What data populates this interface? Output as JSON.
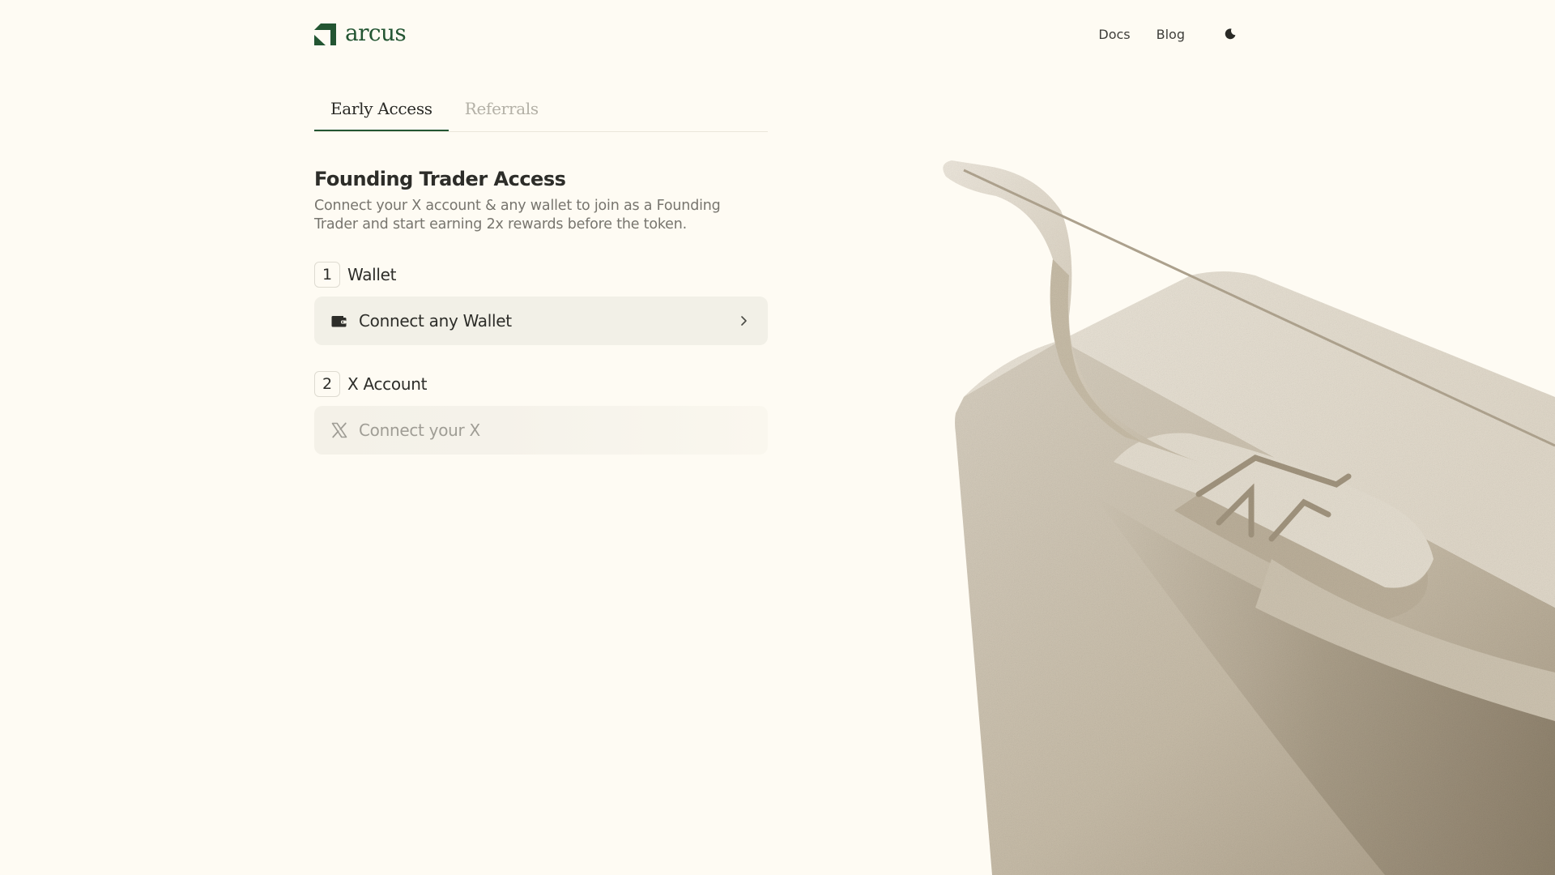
{
  "header": {
    "brand_name": "arcus",
    "nav": {
      "docs": "Docs",
      "blog": "Blog"
    }
  },
  "tabs": [
    {
      "label": "Early Access",
      "active": true
    },
    {
      "label": "Referrals",
      "active": false
    }
  ],
  "main": {
    "title": "Founding Trader Access",
    "subtitle": "Connect your X account & any wallet to join as a Founding Trader and start earning 2x rewards before the token.",
    "steps": [
      {
        "number": "1",
        "label": "Wallet",
        "button": {
          "label": "Connect any Wallet",
          "icon": "wallet-icon",
          "enabled": true
        }
      },
      {
        "number": "2",
        "label": "X Account",
        "button": {
          "label": "Connect your X",
          "icon": "x-logo-icon",
          "enabled": false
        }
      }
    ]
  },
  "colors": {
    "background": "#fefbf3",
    "brand_green": "#235532",
    "button_bg": "#f2f0e7",
    "muted_text": "#77756e"
  }
}
